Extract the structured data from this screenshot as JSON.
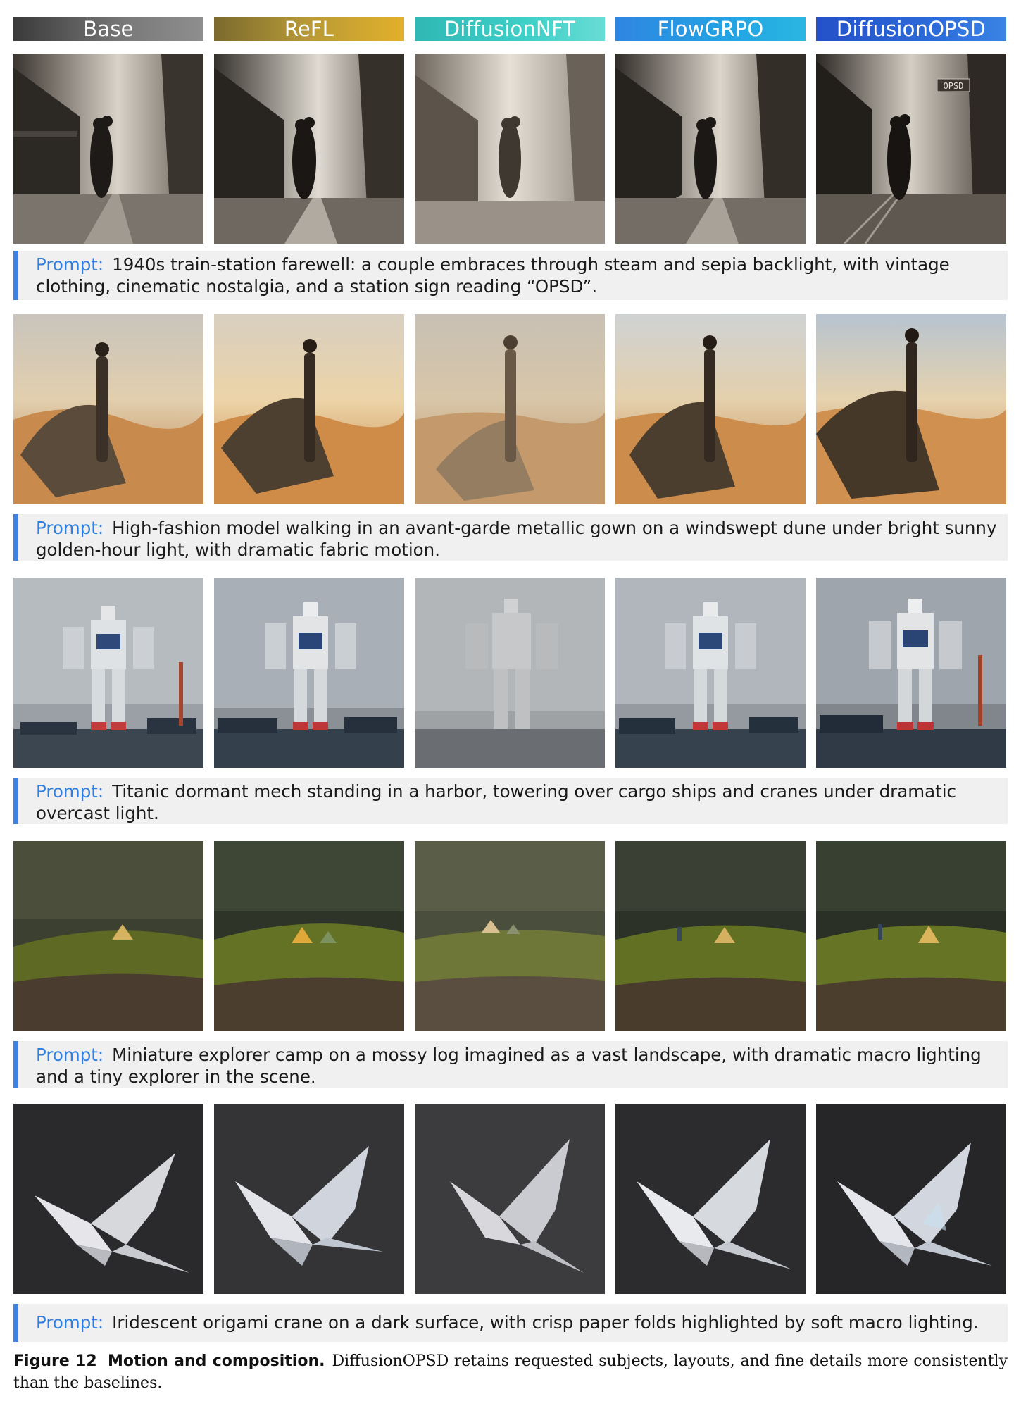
{
  "headers": [
    "Base",
    "ReFL",
    "DiffusionNFT",
    "FlowGRPO",
    "DiffusionOPSD"
  ],
  "colors": {
    "prompt_label": "#2f7fe0",
    "accent_bar": "#3d82e6",
    "prompt_bg": "#f0f0f0"
  },
  "rows": [
    {
      "scene": "train-station",
      "prompt_label": "Prompt:",
      "prompt": "1940s train-station farewell: a couple embraces through steam and sepia backlight, with vintage clothing, cinematic nostalgia, and a station sign reading “OPSD”.",
      "sign_text": "OPSD"
    },
    {
      "scene": "desert-fashion",
      "prompt_label": "Prompt:",
      "prompt": "High-fashion model walking in an avant-garde metallic gown on a windswept dune under bright sunny golden-hour light, with dramatic fabric motion."
    },
    {
      "scene": "harbor-mech",
      "prompt_label": "Prompt:",
      "prompt": "Titanic dormant mech standing in a harbor, towering over cargo ships and cranes under dramatic overcast light."
    },
    {
      "scene": "moss-camp",
      "prompt_label": "Prompt:",
      "prompt": "Miniature explorer camp on a mossy log imagined as a vast landscape, with dramatic macro lighting and a tiny explorer in the scene."
    },
    {
      "scene": "origami-crane",
      "prompt_label": "Prompt:",
      "prompt": "Iridescent origami crane on a dark surface, with crisp paper folds highlighted by soft macro lighting."
    }
  ],
  "caption": {
    "label": "Figure 12",
    "title": "Motion and composition.",
    "text": "DiffusionOPSD retains requested subjects, layouts, and fine details more consistently than the baselines."
  }
}
